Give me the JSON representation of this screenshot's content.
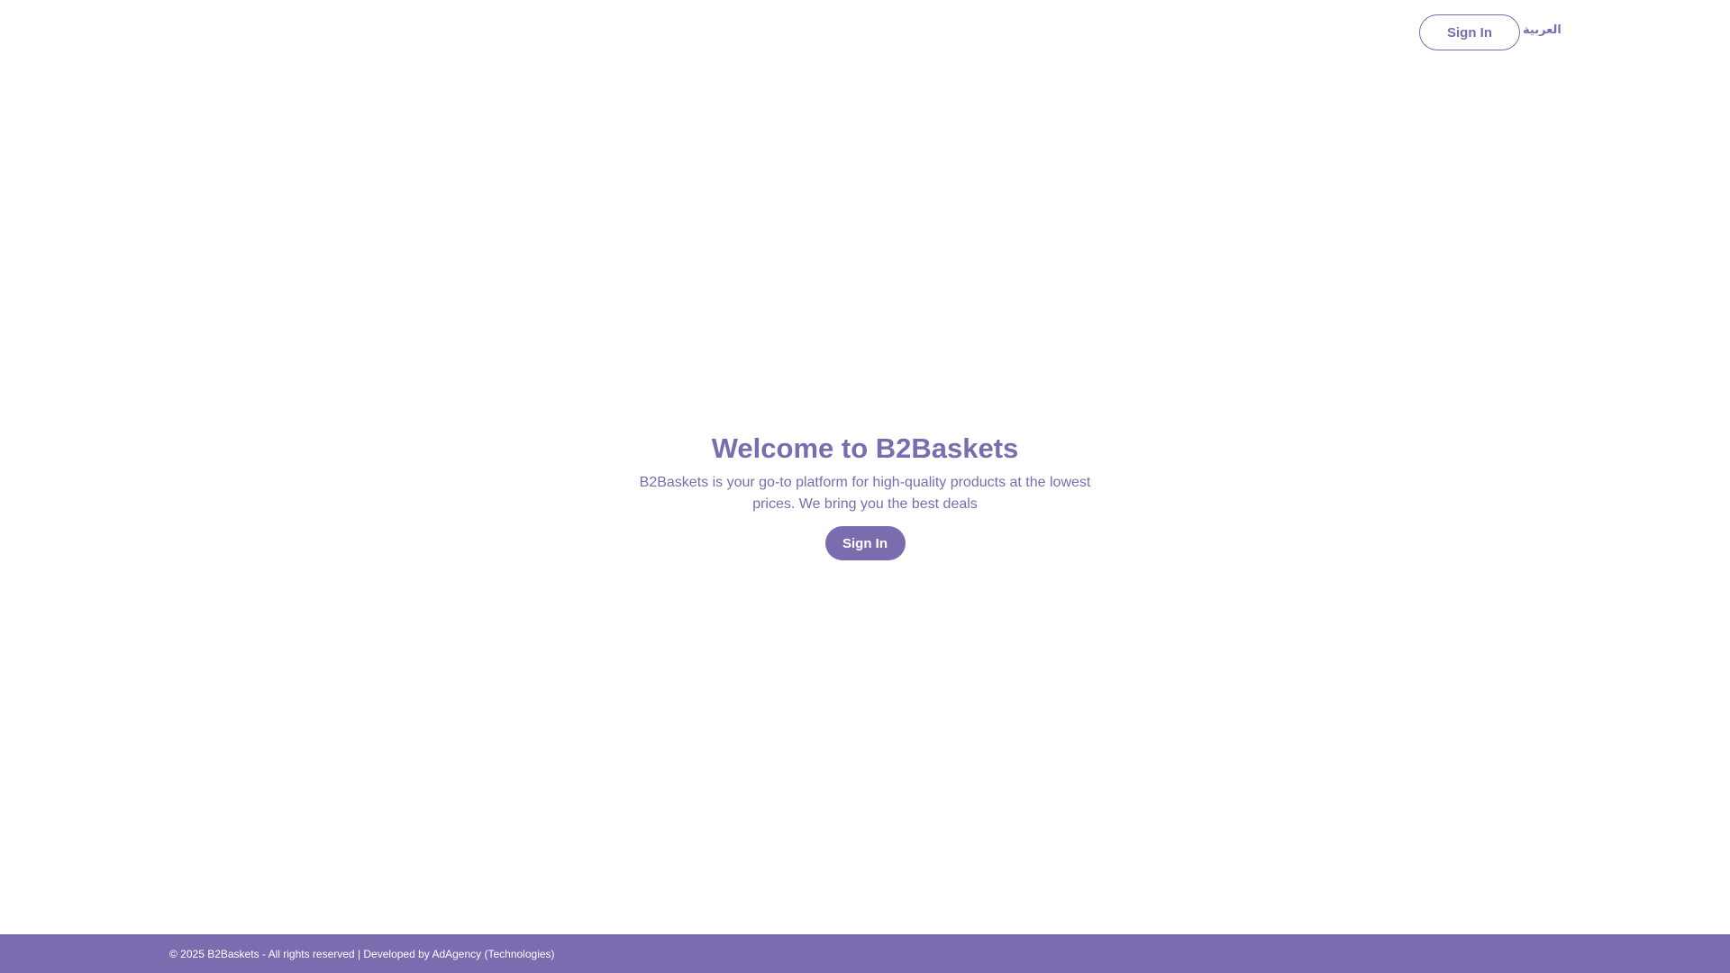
{
  "header": {
    "signin_label": "Sign In",
    "language_label": "العربية"
  },
  "hero": {
    "title": "Welcome to B2Baskets",
    "description": "B2Baskets is your go-to platform for high-quality products at the lowest prices. We bring you the best deals",
    "signin_label": "Sign In"
  },
  "footer": {
    "copyright": "© 2025 B2Baskets - All rights reserved | Developed by ",
    "developer": "AdAgency (Technologies)"
  },
  "colors": {
    "accent": "#7b6cb0",
    "background": "#ffffff",
    "footer_text": "#ffffff"
  }
}
